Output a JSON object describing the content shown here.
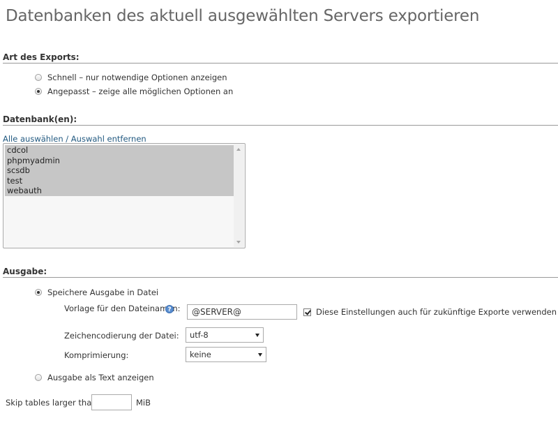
{
  "page": {
    "title": "Datenbanken des aktuell ausgewählten Servers exportieren"
  },
  "export_type": {
    "heading": "Art des Exports:",
    "options": [
      {
        "label": "Schnell – nur notwendige Optionen anzeigen",
        "checked": false
      },
      {
        "label": "Angepasst – zeige alle möglichen Optionen an",
        "checked": true
      }
    ]
  },
  "databases": {
    "heading": "Datenbank(en):",
    "select_all_link": "Alle auswählen / Auswahl entfernen",
    "items": [
      "cdcol",
      "phpmyadmin",
      "scsdb",
      "test",
      "webauth"
    ]
  },
  "output": {
    "heading": "Ausgabe:",
    "save_to_file_label": "Speichere Ausgabe in Datei",
    "save_to_file_checked": true,
    "filename_template_label": "Vorlage für den Dateinamen:",
    "filename_template_value": "@SERVER@",
    "remember_label": "Diese Einstellungen auch für zukünftige Exporte verwenden",
    "remember_checked": true,
    "charset_label": "Zeichencodierung der Datei:",
    "charset_value": "utf-8",
    "compression_label": "Komprimierung:",
    "compression_value": "keine",
    "as_text_label": "Ausgabe als Text anzeigen",
    "as_text_checked": false
  },
  "skip_tables": {
    "label": "Skip tables larger than",
    "value": "",
    "unit": "MiB"
  },
  "icons": {
    "help": "help-icon"
  }
}
